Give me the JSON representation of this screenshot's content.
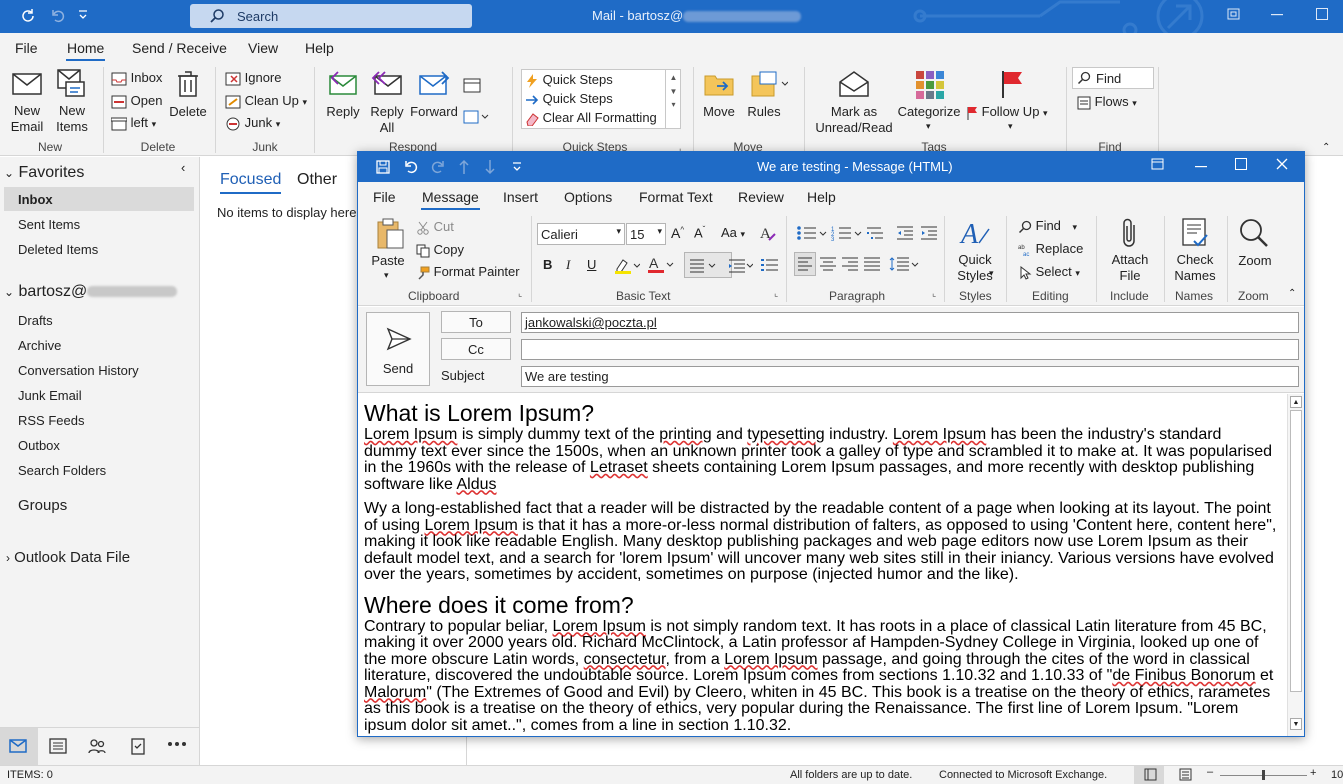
{
  "app": {
    "title_prefix": "Mail - bartosz@",
    "search_placeholder": "Search"
  },
  "menu": [
    "File",
    "Home",
    "Send / Receive",
    "View",
    "Help"
  ],
  "ribbon": {
    "new_email": "New\nEmail",
    "new_items": "New\nItems",
    "new_group": "New",
    "inbox": "Inbox",
    "open": "Open",
    "left": "left",
    "delete": "Delete",
    "delete_group": "Delete",
    "ignore": "Ignore",
    "clean_up": "Clean Up",
    "junk": "Junk",
    "junk_group": "Junk",
    "reply": "Reply",
    "reply_all": "Reply\nAll",
    "forward": "Forward",
    "respond_group": "Respond",
    "quick_steps_1": "Quick Steps",
    "quick_steps_2": "Quick Steps",
    "clear_all": "Clear All Formatting",
    "quick_steps_group": "Quick Steps",
    "move": "Move",
    "rules": "Rules",
    "move_group": "Move",
    "mark_unread": "Mark as\nUnread/Read",
    "categorize": "Categorize",
    "follow_up": "Follow Up",
    "tags_group": "Tags",
    "find": "Find",
    "flows": "Flows",
    "find_group": "Find"
  },
  "nav": {
    "favorites": "Favorites",
    "inbox": "Inbox",
    "sent_items": "Sent Items",
    "deleted_items": "Deleted Items",
    "account_prefix": "bartosz@",
    "drafts": "Drafts",
    "archive": "Archive",
    "conversation_history": "Conversation History",
    "junk_email": "Junk Email",
    "rss_feeds": "RSS Feeds",
    "outbox": "Outbox",
    "search_folders": "Search Folders",
    "groups": "Groups",
    "outlook_data_file": "Outlook Data File"
  },
  "list": {
    "focused": "Focused",
    "other": "Other",
    "empty": "No items to display here"
  },
  "status": {
    "items": "ITEMS: 0",
    "folders": "All folders are up to date.",
    "connected": "Connected to Microsoft Exchange.",
    "zoom": "10"
  },
  "compose": {
    "title": "We are testing  -  Message (HTML)",
    "menu": [
      "File",
      "Message",
      "Insert",
      "Options",
      "Format Text",
      "Review",
      "Help"
    ],
    "ribbon": {
      "paste": "Paste",
      "cut": "Cut",
      "copy": "Copy",
      "format_painter": "Format Painter",
      "clipboard_group": "Clipboard",
      "font_name": "Calieri",
      "font_size": "15",
      "basic_text_group": "Basic Text",
      "paragraph_group": "Paragraph",
      "quick_styles": "Quick\nStyles",
      "styles_group": "Styles",
      "find": "Find",
      "replace": "Replace",
      "select": "Select",
      "editing_group": "Editing",
      "attach_file": "Attach\nFile",
      "include_group": "Include",
      "check_names": "Check\nNames",
      "names_group": "Names",
      "zoom": "Zoom",
      "zoom_group": "Zoom",
      "bold": "B",
      "italic": "I",
      "underline": "U"
    },
    "send": "Send",
    "to_label": "To",
    "cc_label": "Cc",
    "subject_label": "Subject",
    "to_value": "jankowalski@poczta.pl",
    "cc_value": "",
    "subject_value": "We are testing"
  },
  "body": {
    "h1": "What is Lorem Ipsum?",
    "h2": "Where does it come from?"
  },
  "colors": {
    "accent": "#1f6bc6",
    "chrome": "#f3f3f3",
    "spell": "#dd3333"
  }
}
